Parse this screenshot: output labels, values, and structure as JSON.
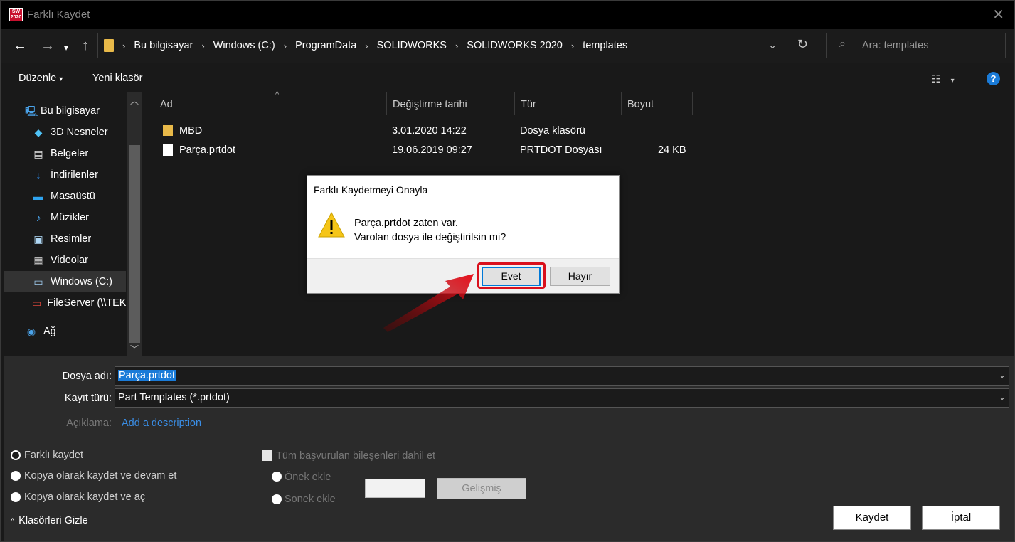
{
  "window": {
    "title": "Farklı Kaydet",
    "app_icon_text": "SW 2020"
  },
  "address": {
    "breadcrumbs": [
      "Bu bilgisayar",
      "Windows (C:)",
      "ProgramData",
      "SOLIDWORKS",
      "SOLIDWORKS 2020",
      "templates"
    ],
    "search_placeholder": "Ara: templates"
  },
  "toolbar": {
    "organize": "Düzenle",
    "new_folder": "Yeni klasör"
  },
  "sidebar": {
    "items": [
      {
        "label": "Bu bilgisayar",
        "icon": "computer-icon"
      },
      {
        "label": "3D Nesneler",
        "icon": "cube-icon"
      },
      {
        "label": "Belgeler",
        "icon": "document-icon"
      },
      {
        "label": "İndirilenler",
        "icon": "download-icon"
      },
      {
        "label": "Masaüstü",
        "icon": "desktop-icon"
      },
      {
        "label": "Müzikler",
        "icon": "music-icon"
      },
      {
        "label": "Resimler",
        "icon": "pictures-icon"
      },
      {
        "label": "Videolar",
        "icon": "video-icon"
      },
      {
        "label": "Windows (C:)",
        "icon": "drive-icon"
      },
      {
        "label": "FileServer (\\\\TEK",
        "icon": "network-drive-icon"
      },
      {
        "label": "Ağ",
        "icon": "network-icon"
      }
    ]
  },
  "filelist": {
    "columns": [
      "Ad",
      "Değiştirme tarihi",
      "Tür",
      "Boyut"
    ],
    "rows": [
      {
        "name": "MBD",
        "date": "3.01.2020 14:22",
        "type": "Dosya klasörü",
        "size": ""
      },
      {
        "name": "Parça.prtdot",
        "date": "19.06.2019 09:27",
        "type": "PRTDOT Dosyası",
        "size": "24 KB"
      }
    ]
  },
  "form": {
    "filename_label": "Dosya adı:",
    "filename_value": "Parça.prtdot",
    "filetype_label": "Kayıt türü:",
    "filetype_value": "Part Templates (*.prtdot)",
    "description_label": "Açıklama:",
    "description_link": "Add a description"
  },
  "options": {
    "save_as": "Farklı kaydet",
    "save_copy_continue": "Kopya olarak kaydet ve devam et",
    "save_copy_open": "Kopya olarak kaydet ve aç",
    "include_refs": "Tüm başvurulan bileşenleri dahil et",
    "add_prefix": "Önek ekle",
    "add_suffix": "Sonek ekle",
    "advanced": "Gelişmiş"
  },
  "footer": {
    "hide_folders": "Klasörleri Gizle",
    "save": "Kaydet",
    "cancel": "İptal"
  },
  "dialog": {
    "title": "Farklı Kaydetmeyi Onayla",
    "message_line1": "Parça.prtdot zaten var.",
    "message_line2": "Varolan dosya ile değiştirilsin mi?",
    "yes": "Evet",
    "no": "Hayır"
  },
  "colors": {
    "accent": "#1a7bd8",
    "highlight": "#d9101c",
    "warning": "#f5c518"
  }
}
